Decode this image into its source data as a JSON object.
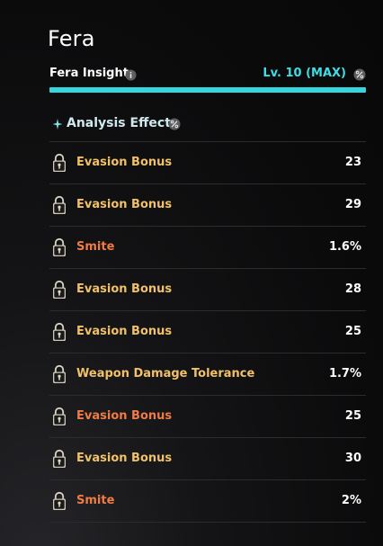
{
  "title": "Fera",
  "insight": {
    "label": "Fera Insight",
    "level_text": "Lv. 10 (MAX)",
    "progress": 1.0
  },
  "section": {
    "label": "Analysis Effect"
  },
  "colors": {
    "gold": "#f1c169",
    "orange": "#ef7b45",
    "cyan": "#3fdde6",
    "bar": "#34d6e0"
  },
  "effects": [
    {
      "label": "Evasion Bonus",
      "value": "23",
      "color": "gold"
    },
    {
      "label": "Evasion Bonus",
      "value": "29",
      "color": "gold"
    },
    {
      "label": "Smite",
      "value": "1.6%",
      "color": "orange"
    },
    {
      "label": "Evasion Bonus",
      "value": "28",
      "color": "gold"
    },
    {
      "label": "Evasion Bonus",
      "value": "25",
      "color": "gold"
    },
    {
      "label": "Weapon Damage Tolerance",
      "value": "1.7%",
      "color": "gold"
    },
    {
      "label": "Evasion Bonus",
      "value": "25",
      "color": "orange"
    },
    {
      "label": "Evasion Bonus",
      "value": "30",
      "color": "gold"
    },
    {
      "label": "Smite",
      "value": "2%",
      "color": "orange"
    }
  ],
  "icons": {
    "info": "info-icon",
    "percent": "percent-icon",
    "sparkle": "sparkle-icon",
    "lock": "lock-icon"
  }
}
